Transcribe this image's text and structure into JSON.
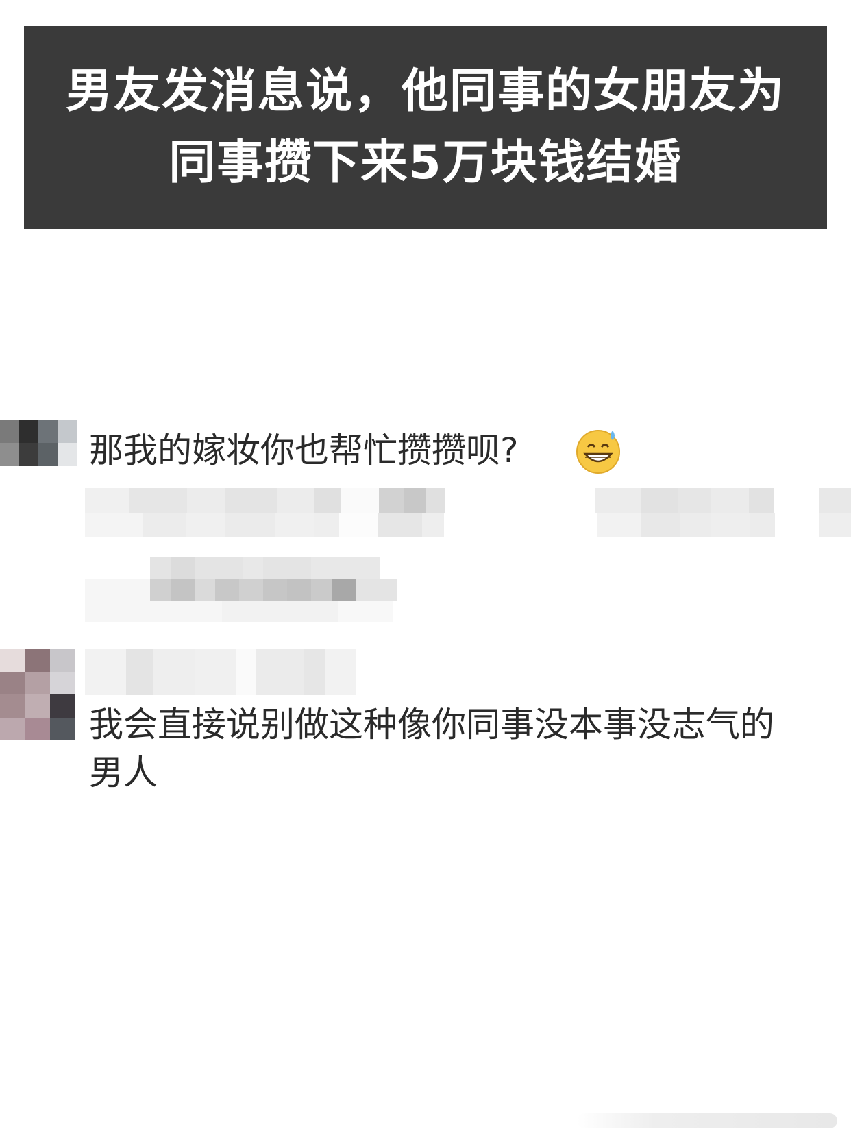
{
  "title": {
    "line1": "男友发消息说，他同事的女朋友为",
    "line2": "同事攒下来5万块钱结婚"
  },
  "comments": [
    {
      "text": "那我的嫁妆你也帮忙攒攒呗?",
      "emoji": "grinning-sweat-emoji"
    },
    {
      "text_line1": "我会直接说别做这种像你同事没本事没志气的",
      "text_line2": "男人"
    }
  ]
}
